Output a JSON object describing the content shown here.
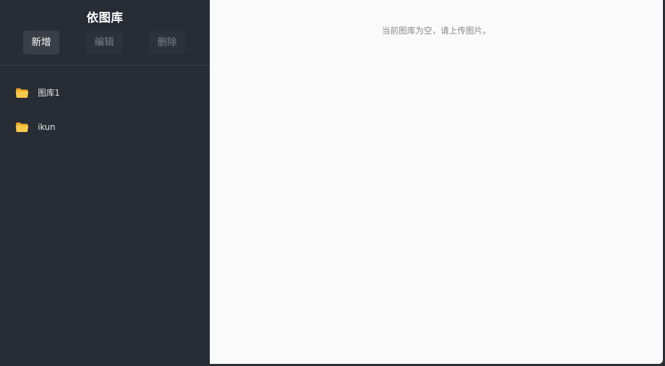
{
  "sidebar": {
    "title": "依图库",
    "toolbar": {
      "add_label": "新增",
      "edit_label": "编辑",
      "delete_label": "删除"
    },
    "galleries": [
      {
        "label": "图库1",
        "icon": "folder-icon"
      },
      {
        "label": "ikun",
        "icon": "folder-icon"
      }
    ]
  },
  "main": {
    "empty_message": "当前图库为空，请上传图片。"
  },
  "colors": {
    "sidebar_bg": "#282c34",
    "folder": "#f5b731",
    "main_bg": "#fafafa"
  }
}
